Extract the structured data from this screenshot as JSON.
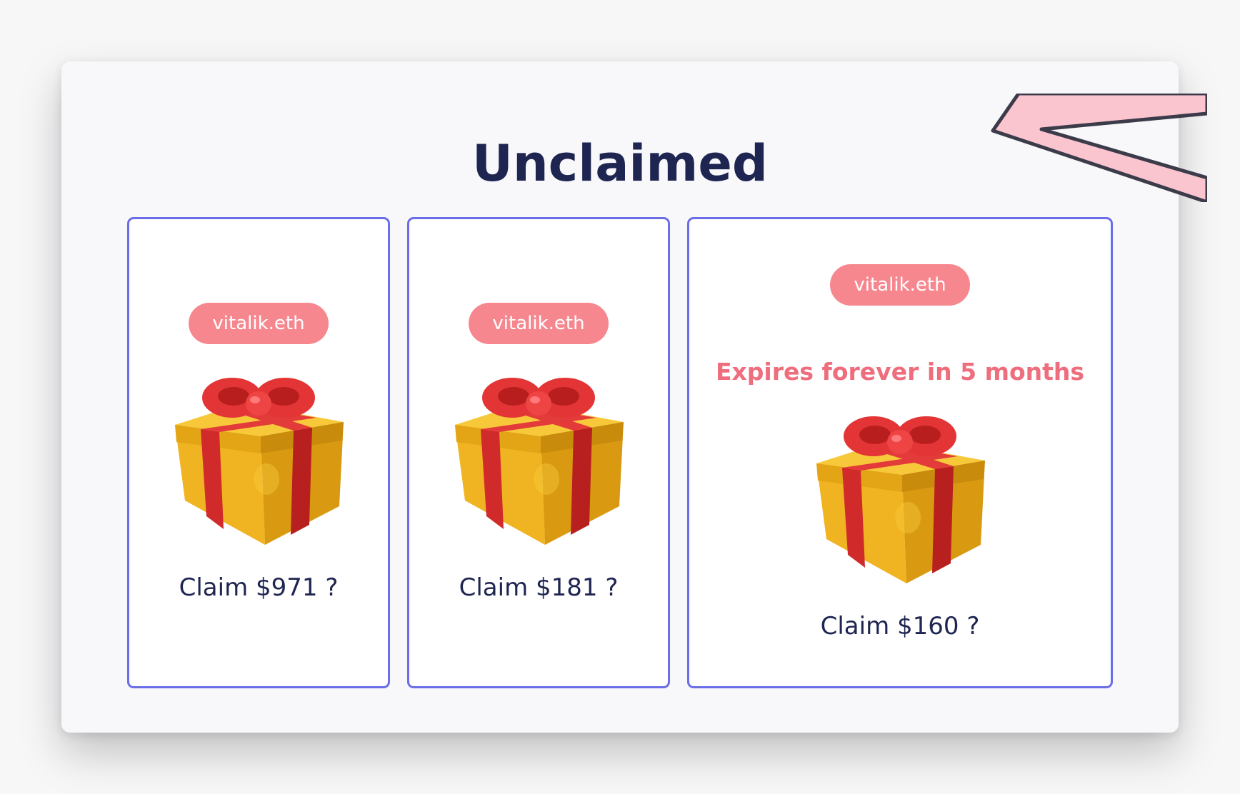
{
  "section": {
    "title": "Unclaimed"
  },
  "cards": [
    {
      "badge": "vitalik.eth",
      "claim": "Claim $971 ?",
      "gift_icon": "gift-icon"
    },
    {
      "badge": "vitalik.eth",
      "claim": "Claim $181 ?",
      "gift_icon": "gift-icon"
    },
    {
      "badge": "vitalik.eth",
      "expires": "Expires forever in 5 months",
      "claim": "Claim $160 ?",
      "gift_icon": "gift-icon"
    }
  ],
  "colors": {
    "title": "#1e2551",
    "card_border": "#6b6ee6",
    "badge_bg": "#f7878f",
    "expires_text": "#ef6e7e",
    "gift_box": "#e2a317",
    "gift_ribbon": "#d62a2a"
  }
}
